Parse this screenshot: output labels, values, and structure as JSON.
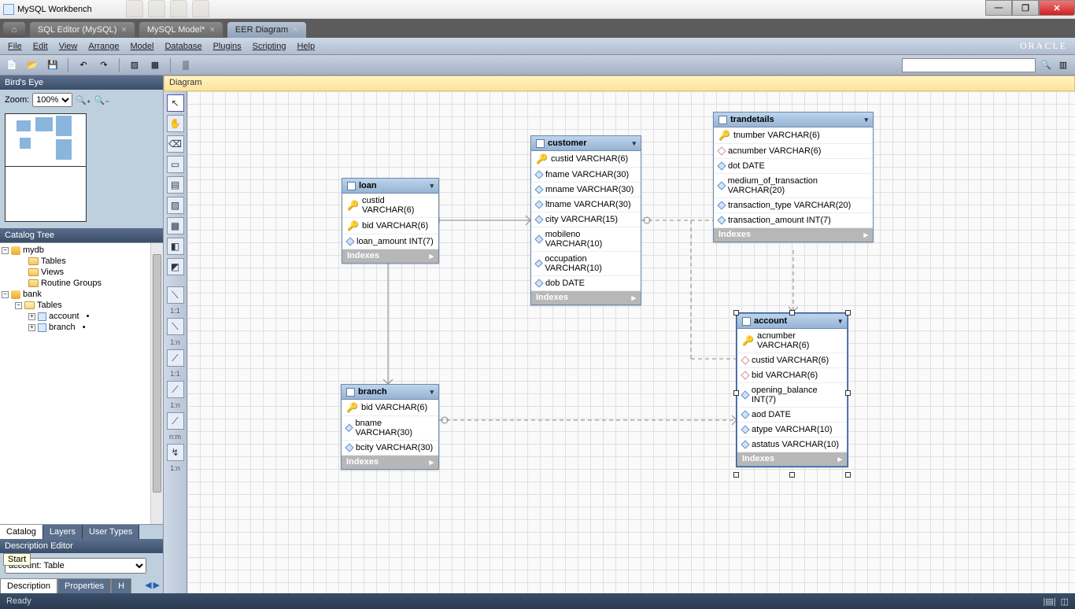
{
  "title": "MySQL Workbench",
  "tabs": [
    {
      "label": "SQL Editor (MySQL)",
      "closeable": true
    },
    {
      "label": "MySQL Model*",
      "closeable": true
    },
    {
      "label": "EER Diagram",
      "closeable": true,
      "active": true
    }
  ],
  "menus": [
    "File",
    "Edit",
    "View",
    "Arrange",
    "Model",
    "Database",
    "Plugins",
    "Scripting",
    "Help"
  ],
  "oracle": "ORACLE",
  "birdseye": {
    "title": "Bird's Eye",
    "zoom_label": "Zoom:",
    "zoom_value": "100%"
  },
  "catalog": {
    "title": "Catalog Tree",
    "nodes": {
      "mydb": "mydb",
      "tables": "Tables",
      "views": "Views",
      "routines": "Routine Groups",
      "bank": "bank",
      "account": "account",
      "branch": "branch",
      "bullet": "•"
    },
    "subtabs": [
      "Catalog",
      "Layers",
      "User Types"
    ]
  },
  "desc": {
    "title": "Description Editor",
    "value": "account: Table"
  },
  "bottom_tabs": {
    "a": "Description",
    "b": "Properties",
    "c": "H"
  },
  "canvas": {
    "title": "Diagram"
  },
  "vtools": {
    "rel_labels": [
      "1:1",
      "1:n",
      "1:1",
      "1:n",
      "n:m",
      "1:n"
    ]
  },
  "entities": {
    "loan": {
      "name": "loan",
      "cols": [
        {
          "k": "pk",
          "t": "custid VARCHAR(6)"
        },
        {
          "k": "pk",
          "t": "bid VARCHAR(6)"
        },
        {
          "k": "d",
          "t": "loan_amount INT(7)"
        }
      ]
    },
    "customer": {
      "name": "customer",
      "cols": [
        {
          "k": "pk",
          "t": "custid VARCHAR(6)"
        },
        {
          "k": "d",
          "t": "fname VARCHAR(30)"
        },
        {
          "k": "d",
          "t": "mname VARCHAR(30)"
        },
        {
          "k": "d",
          "t": "ltname VARCHAR(30)"
        },
        {
          "k": "d",
          "t": "city VARCHAR(15)"
        },
        {
          "k": "d",
          "t": "mobileno VARCHAR(10)"
        },
        {
          "k": "d",
          "t": "occupation VARCHAR(10)"
        },
        {
          "k": "d",
          "t": "dob DATE"
        }
      ]
    },
    "trandetails": {
      "name": "trandetails",
      "cols": [
        {
          "k": "pk",
          "t": "tnumber VARCHAR(6)"
        },
        {
          "k": "fk",
          "t": "acnumber VARCHAR(6)"
        },
        {
          "k": "d",
          "t": "dot DATE"
        },
        {
          "k": "d",
          "t": "medium_of_transaction VARCHAR(20)"
        },
        {
          "k": "d",
          "t": "transaction_type VARCHAR(20)"
        },
        {
          "k": "d",
          "t": "transaction_amount INT(7)"
        }
      ]
    },
    "branch": {
      "name": "branch",
      "cols": [
        {
          "k": "pk",
          "t": "bid VARCHAR(6)"
        },
        {
          "k": "d",
          "t": "bname VARCHAR(30)"
        },
        {
          "k": "d",
          "t": "bcity VARCHAR(30)"
        }
      ]
    },
    "account": {
      "name": "account",
      "cols": [
        {
          "k": "pk",
          "t": "acnumber VARCHAR(6)"
        },
        {
          "k": "fk",
          "t": "custid VARCHAR(6)"
        },
        {
          "k": "fk",
          "t": "bid VARCHAR(6)"
        },
        {
          "k": "d",
          "t": "opening_balance INT(7)"
        },
        {
          "k": "d",
          "t": "aod DATE"
        },
        {
          "k": "d",
          "t": "atype VARCHAR(10)"
        },
        {
          "k": "d",
          "t": "astatus VARCHAR(10)"
        }
      ]
    }
  },
  "indexes_label": "Indexes",
  "start_tip": "Start",
  "status": "Ready"
}
